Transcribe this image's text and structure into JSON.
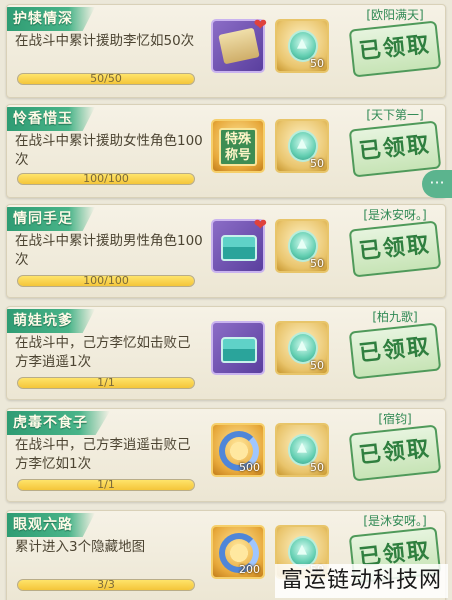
{
  "achievements": [
    {
      "title": "护犊情深",
      "desc": "在战斗中累计援助李忆如50次",
      "progress_text": "50/50",
      "progress": 1.0,
      "reward_item": "scroll-icon",
      "reward_count": "50",
      "claimer": "[欧阳满天]",
      "button": "已领取"
    },
    {
      "title": "怜香惜玉",
      "desc": "在战斗中累计援助女性角色100次",
      "progress_text": "100/100",
      "progress": 1.0,
      "reward_item": "special-title-badge",
      "reward_item_label": "特殊称号",
      "reward_count": "50",
      "claimer": "[天下第一]",
      "button": "已领取"
    },
    {
      "title": "情同手足",
      "desc": "在战斗中累计援助男性角色100次",
      "progress_text": "100/100",
      "progress": 1.0,
      "reward_item": "chest-icon",
      "reward_count": "50",
      "claimer": "[是沐安呀。]",
      "button": "已领取"
    },
    {
      "title": "萌娃坑爹",
      "desc": "在战斗中，己方李忆如击败己方李逍遥1次",
      "progress_text": "1/1",
      "progress": 1.0,
      "reward_item": "chest-icon",
      "reward_count": "50",
      "claimer": "[柏九歌]",
      "button": "已领取"
    },
    {
      "title": "虎毒不食子",
      "desc": "在战斗中，己方李逍遥击败己方李忆如1次",
      "progress_text": "1/1",
      "progress": 1.0,
      "reward_item": "ring-icon",
      "reward_item_count": "500",
      "reward_count": "50",
      "claimer": "[宿钧]",
      "button": "已领取"
    },
    {
      "title": "眼观六路",
      "desc": "累计进入3个隐藏地图",
      "progress_text": "3/3",
      "progress": 1.0,
      "reward_item": "ring-icon",
      "reward_item_count": "200",
      "reward_count": "50",
      "claimer": "[是沐安呀。]",
      "button": "已领取"
    }
  ],
  "watermark": "富运链动科技网",
  "chat_icon": "chat-bubble-icon"
}
